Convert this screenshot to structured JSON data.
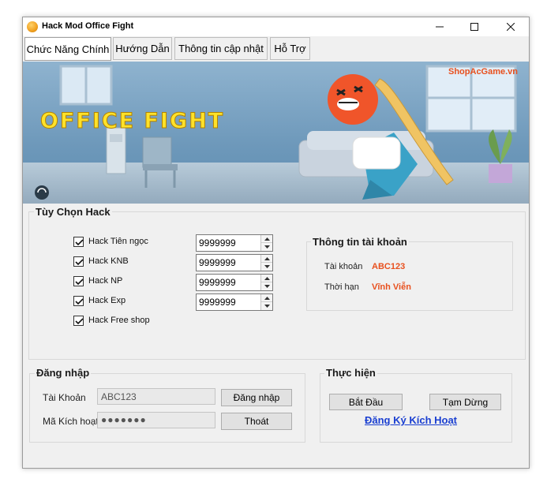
{
  "window": {
    "title": "Hack Mod Office Fight"
  },
  "tabs": [
    {
      "label": "Chức Năng Chính"
    },
    {
      "label": "Hướng Dẫn"
    },
    {
      "label": "Thông tin cập nhật"
    },
    {
      "label": "Hỗ Trợ"
    }
  ],
  "banner": {
    "headline": "OFFICE FIGHT",
    "watermark": "ShopAcGame.vn"
  },
  "hack_options": {
    "legend": "Tùy Chọn Hack",
    "items": [
      {
        "label": "Hack Tiên ngọc",
        "checked": true,
        "value": "9999999"
      },
      {
        "label": "Hack KNB",
        "checked": true,
        "value": "9999999"
      },
      {
        "label": "Hack NP",
        "checked": true,
        "value": "9999999"
      },
      {
        "label": "Hack Exp",
        "checked": true,
        "value": "9999999"
      },
      {
        "label": "Hack Free shop",
        "checked": true
      }
    ]
  },
  "account_info": {
    "legend": "Thông tin tài khoản",
    "account_label": "Tài khoản",
    "account_value": "ABC123",
    "term_label": "Thời hạn",
    "term_value": "Vĩnh Viễn"
  },
  "login": {
    "legend": "Đăng nhập",
    "account_label": "Tài Khoản",
    "account_value": "ABC123",
    "code_label": "Mã Kích hoạt",
    "code_value": "●●●●●●●",
    "login_button": "Đăng nhập",
    "exit_button": "Thoát"
  },
  "actions": {
    "legend": "Thực hiện",
    "start_button": "Bắt Đầu",
    "pause_button": "Tạm Dừng",
    "register_link": "Đăng Ký Kích Hoạt"
  },
  "colors": {
    "accent": "#e8501e",
    "link": "#1a3fd1",
    "headline": "#ffe22a"
  }
}
